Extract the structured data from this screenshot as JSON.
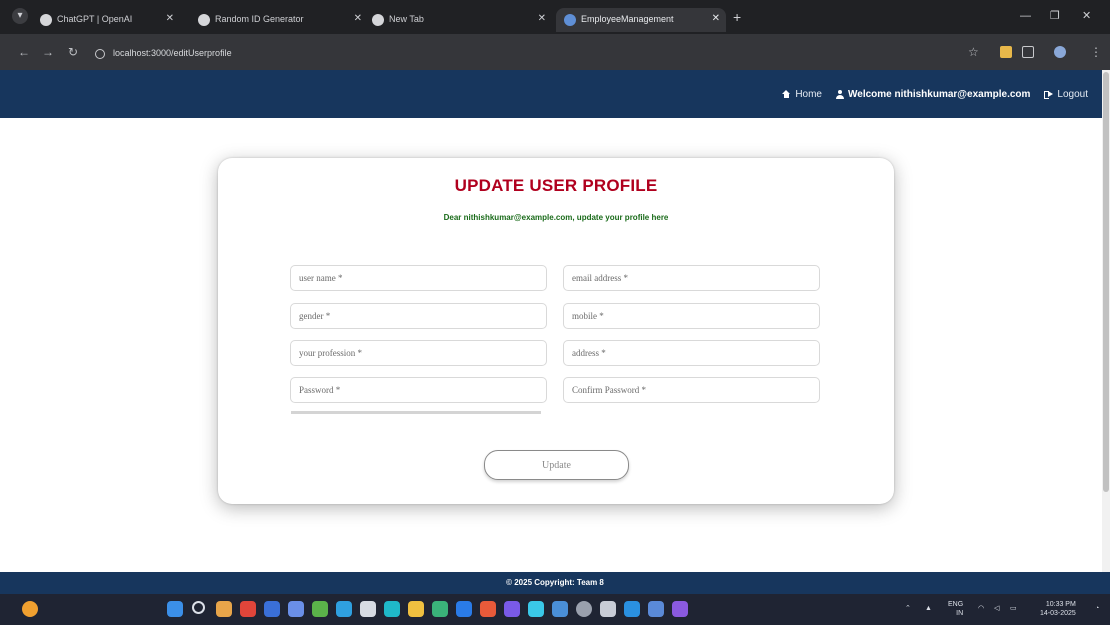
{
  "browser": {
    "tabs": [
      {
        "label": "ChatGPT | OpenAI",
        "active": false
      },
      {
        "label": "Random ID Generator",
        "active": false
      },
      {
        "label": "New Tab",
        "active": false
      },
      {
        "label": "EmployeeManagement",
        "active": true
      }
    ],
    "url": "localhost:3000/editUserprofile"
  },
  "header": {
    "home_label": "Home",
    "welcome_label": "Welcome nithishkumar@example.com",
    "logout_label": "Logout"
  },
  "form": {
    "title": "UPDATE USER PROFILE",
    "subtitle": "Dear nithishkumar@example.com, update your profile here",
    "fields": {
      "username": "user name *",
      "email": "email address *",
      "gender": "gender *",
      "mobile": "mobile *",
      "profession": "your profession *",
      "address": "address *",
      "password": "Password *",
      "confirm_password": "Confirm Password *"
    },
    "update_label": "Update"
  },
  "footer": {
    "copyright": "© 2025 Copyright: Team 8"
  },
  "taskbar": {
    "lang_line1": "ENG",
    "lang_line2": "IN",
    "time": "10:33 PM",
    "date": "14-03-2025"
  },
  "colors": {
    "header_bg": "#17365d",
    "title": "#b0001e",
    "subtitle": "#1a6b1a"
  }
}
